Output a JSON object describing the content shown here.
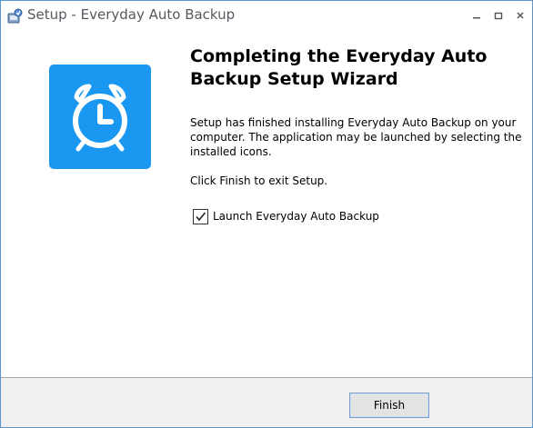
{
  "window": {
    "title": "Setup - Everyday Auto Backup",
    "icons": {
      "app": "setup-installer-icon",
      "minimize": "minimize-icon",
      "maximize": "maximize-icon",
      "close": "close-icon"
    }
  },
  "wizard": {
    "logo_icon": "alarm-clock-icon",
    "logo_color": "#1a97f0",
    "heading": "Completing the Everyday Auto Backup Setup Wizard",
    "description": "Setup has finished installing Everyday Auto Backup on your computer. The application may be launched by selecting the installed icons.",
    "finish_note": "Click Finish to exit Setup.",
    "launch_checkbox": {
      "label": "Launch Everyday Auto Backup",
      "checked": true
    }
  },
  "footer": {
    "finish_label": "Finish"
  }
}
